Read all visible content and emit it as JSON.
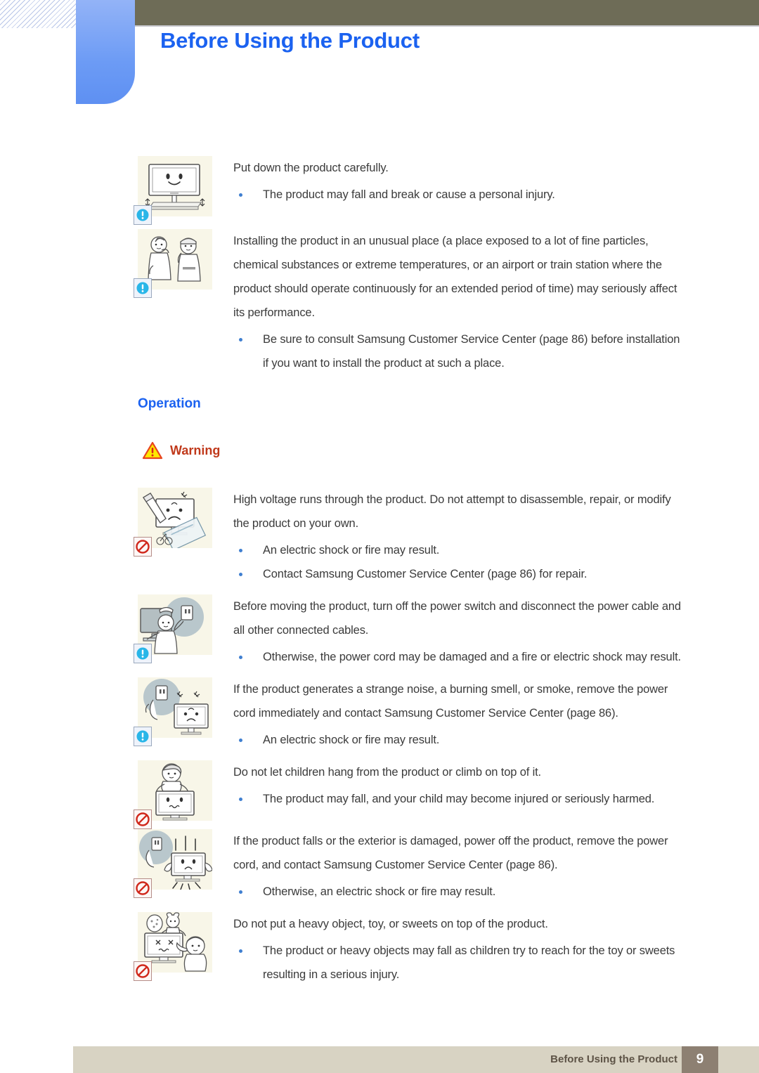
{
  "header": {
    "title": "Before Using the Product",
    "title_color": "#1b62f0",
    "bar_color": "#6e6c57",
    "tab_color": "#6c9bf5"
  },
  "sections": {
    "operation_heading": "Operation",
    "warning_label": "Warning",
    "warning_icon": "warning-triangle-icon"
  },
  "blocks": [
    {
      "icon": "monitor-placed-on-stand-icon",
      "badge": "caution-exclamation-badge",
      "paragraphs": [
        "Put down the product carefully."
      ],
      "bullets": [
        "The product may fall and break or cause a personal injury."
      ]
    },
    {
      "icon": "people-in-dusty-place-icon",
      "badge": "caution-exclamation-badge",
      "paragraphs": [
        "Installing the product in an unusual place (a place exposed to a lot of fine particles, chemical substances or extreme temperatures, or an airport or train station where the product should operate continuously for an extended period of time) may seriously affect its performance."
      ],
      "bullets": [
        "Be sure to consult Samsung Customer Service Center (page 86) before installation if you want to install the product at such a place."
      ]
    },
    {
      "icon": "disassemble-monitor-screwdriver-icon",
      "badge": "prohibited-badge",
      "paragraphs": [
        "High voltage runs through the product. Do not attempt to disassemble, repair, or modify the product on your own."
      ],
      "bullets": [
        "An electric shock or fire may result.",
        "Contact Samsung Customer Service Center (page 86) for repair."
      ]
    },
    {
      "icon": "unplug-power-before-moving-icon",
      "badge": "caution-exclamation-badge",
      "paragraphs": [
        "Before moving the product, turn off the power switch and disconnect the power cable and all other connected cables."
      ],
      "bullets": [
        "Otherwise, the power cord may be damaged and a fire or electric shock may result."
      ]
    },
    {
      "icon": "smoke-burning-smell-unplug-icon",
      "badge": "caution-exclamation-badge",
      "paragraphs": [
        "If the product generates a strange noise, a burning smell, or smoke, remove the power cord immediately and contact Samsung Customer Service Center (page 86)."
      ],
      "bullets": [
        "An electric shock or fire may result."
      ]
    },
    {
      "icon": "child-hanging-on-monitor-icon",
      "badge": "prohibited-badge",
      "paragraphs": [
        "Do not let children hang from the product or climb on top of it."
      ],
      "bullets": [
        "The product may fall, and your child may become injured or seriously harmed."
      ]
    },
    {
      "icon": "fallen-damaged-monitor-icon",
      "badge": "prohibited-badge",
      "paragraphs": [
        "If the product falls or the exterior is damaged, power off the product, remove the power cord, and contact Samsung Customer Service Center (page 86)."
      ],
      "bullets": [
        "Otherwise, an electric shock or fire may result."
      ]
    },
    {
      "icon": "toy-on-top-of-monitor-icon",
      "badge": "prohibited-badge",
      "paragraphs": [
        "Do not put a heavy object, toy, or sweets on top of the product."
      ],
      "bullets": [
        "The product or heavy objects may fall as children try to reach for the toy or sweets resulting in a serious injury."
      ]
    }
  ],
  "footer": {
    "text": "Before Using the Product",
    "page_number": "9",
    "bar_color": "#d8d3c3",
    "page_box_color": "#8d8072"
  }
}
